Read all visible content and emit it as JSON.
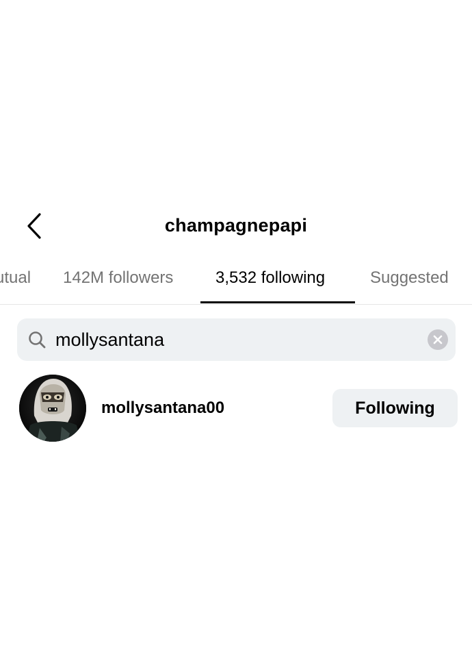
{
  "header": {
    "title": "champagnepapi",
    "back_icon": "chevron-left-icon"
  },
  "tabs": [
    {
      "label": "Mutual",
      "active": false
    },
    {
      "label": "142M followers",
      "active": false
    },
    {
      "label": "3,532 following",
      "active": true
    },
    {
      "label": "Suggested",
      "active": false
    }
  ],
  "search": {
    "value": "mollysantana",
    "icon": "search-icon",
    "clear_icon": "clear-icon"
  },
  "results": [
    {
      "username": "mollysantana00",
      "button_label": "Following"
    }
  ],
  "colors": {
    "muted_text": "#737373",
    "field_background": "#eef1f3",
    "clear_button": "#c7c7cc"
  }
}
